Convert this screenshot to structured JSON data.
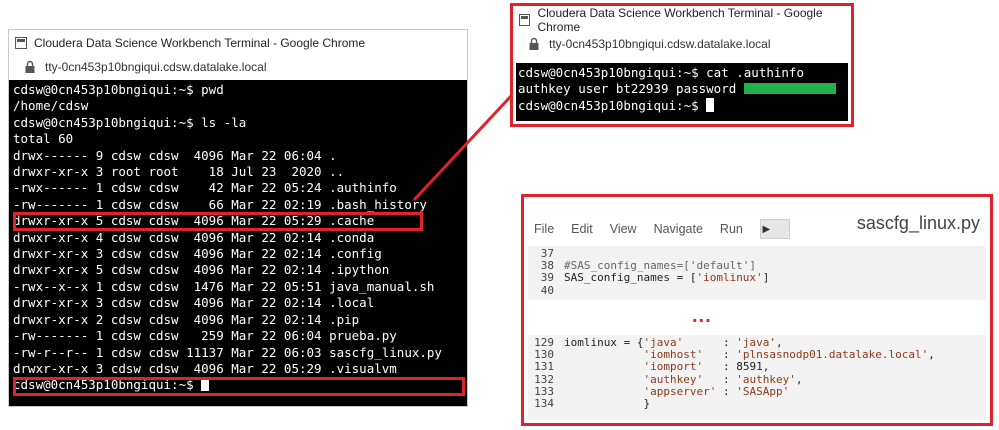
{
  "terminal1": {
    "window_title": "Cloudera Data Science Workbench Terminal - Google Chrome",
    "url": "tty-0cn453p10bngiqui.cdsw.datalake.local",
    "lines": [
      "cdsw@0cn453p10bngiqui:~$ pwd",
      "/home/cdsw",
      "cdsw@0cn453p10bngiqui:~$ ls -la",
      "total 60",
      "drwx------ 9 cdsw cdsw  4096 Mar 22 06:04 .",
      "drwxr-xr-x 3 root root    18 Jul 23  2020 ..",
      "-rwx------ 1 cdsw cdsw    42 Mar 22 05:24 .authinfo",
      "-rw------- 1 cdsw cdsw    66 Mar 22 02:19 .bash_history",
      "drwxr-xr-x 5 cdsw cdsw  4096 Mar 22 05:29 .cache",
      "drwxr-xr-x 4 cdsw cdsw  4096 Mar 22 02:14 .conda",
      "drwxr-xr-x 3 cdsw cdsw  4096 Mar 22 02:14 .config",
      "drwxr-xr-x 5 cdsw cdsw  4096 Mar 22 02:14 .ipython",
      "-rwx--x--x 1 cdsw cdsw  1476 Mar 22 05:51 java_manual.sh",
      "drwxr-xr-x 3 cdsw cdsw  4096 Mar 22 02:14 .local",
      "drwxr-xr-x 2 cdsw cdsw  4096 Mar 22 02:14 .pip",
      "-rw------- 1 cdsw cdsw   259 Mar 22 06:04 prueba.py",
      "-rw-r--r-- 1 cdsw cdsw 11137 Mar 22 06:03 sascfg_linux.py",
      "drwxr-xr-x 3 cdsw cdsw  4096 Mar 22 05:29 .visualvm"
    ],
    "prompt": "cdsw@0cn453p10bngiqui:~$ "
  },
  "terminal2": {
    "window_title": "Cloudera Data Science Workbench Terminal - Google Chrome",
    "url": "tty-0cn453p10bngiqui.cdsw.datalake.local",
    "line1": "cdsw@0cn453p10bngiqui:~$ cat .authinfo",
    "line2": "authkey user bt22939 password ",
    "prompt": "cdsw@0cn453p10bngiqui:~$ "
  },
  "editor": {
    "menu": [
      "File",
      "Edit",
      "View",
      "Navigate",
      "Run"
    ],
    "run_symbol": "▶",
    "filename": "sascfg_linux.py",
    "ellipsis": "...",
    "block_a": [
      {
        "ln": "37",
        "code": ""
      },
      {
        "ln": "38",
        "code": "#SAS_config_names=['default']"
      },
      {
        "ln": "39",
        "code": "SAS_config_names = ['iomlinux']"
      },
      {
        "ln": "40",
        "code": ""
      }
    ],
    "block_b": [
      {
        "ln": "129",
        "code": "iomlinux = {'java'      : 'java',"
      },
      {
        "ln": "130",
        "code": "            'iomhost'   : 'plnsasnodp01.datalake.local',"
      },
      {
        "ln": "131",
        "code": "            'iomport'   : 8591,"
      },
      {
        "ln": "132",
        "code": "            'authkey'   : 'authkey',"
      },
      {
        "ln": "133",
        "code": "            'appserver' : 'SASApp'"
      },
      {
        "ln": "134",
        "code": "            }"
      }
    ]
  },
  "colors": {
    "highlight": "#e0222a",
    "redaction": "#22b14c",
    "terminal_bg": "#000000"
  }
}
